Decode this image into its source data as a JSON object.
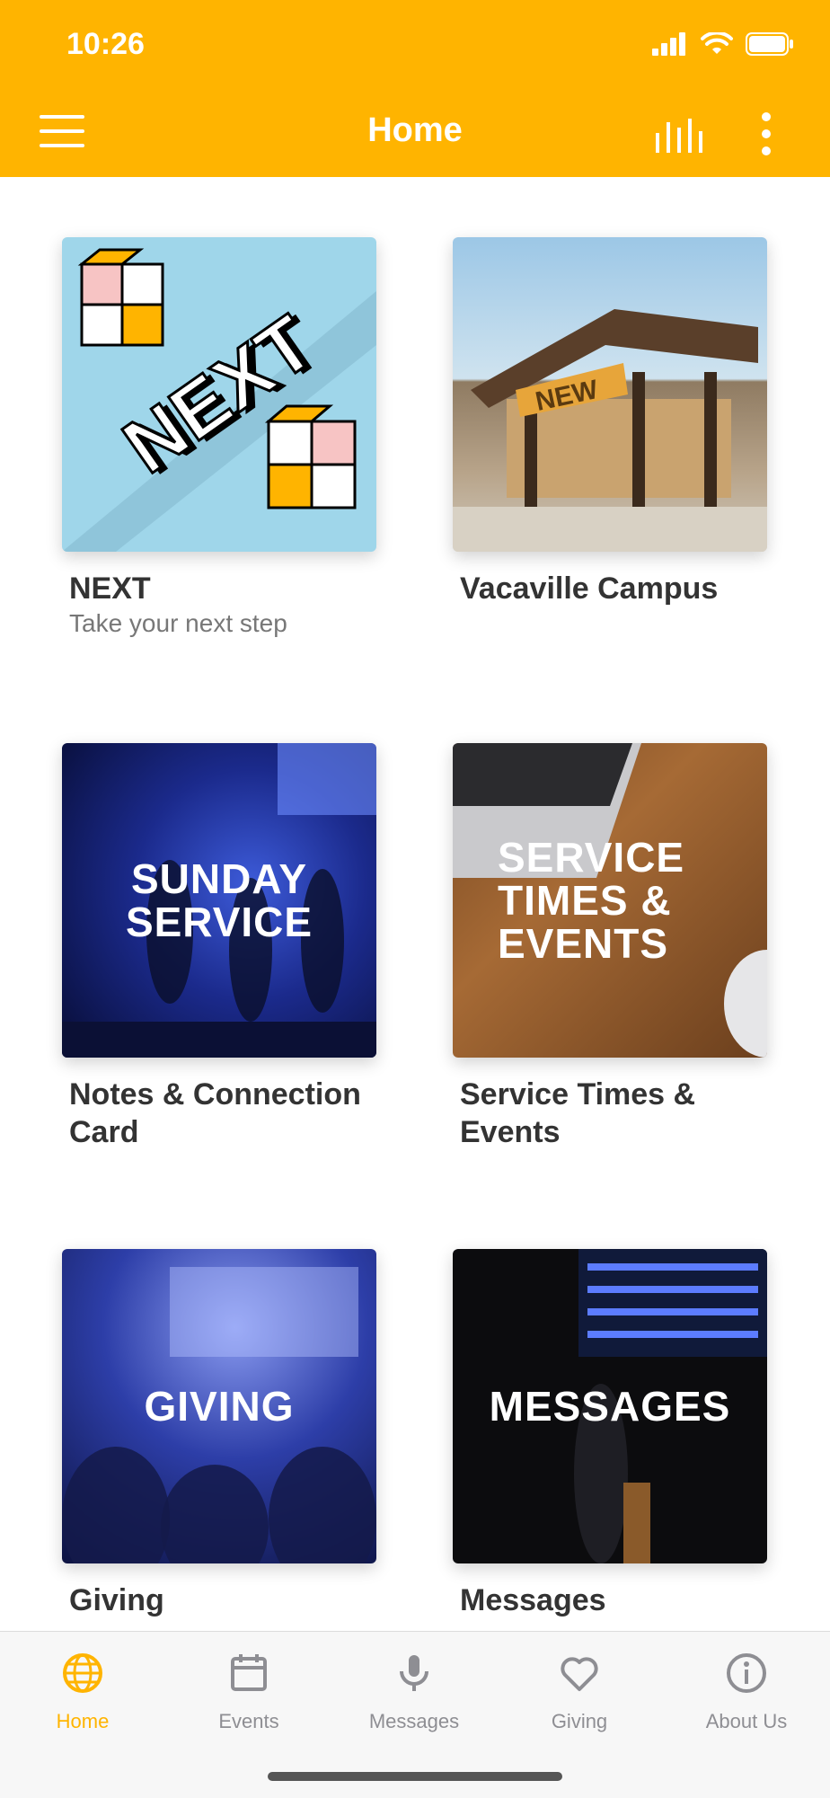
{
  "status": {
    "time": "10:26"
  },
  "header": {
    "title": "Home",
    "bg_color": "#FFB400"
  },
  "tiles": [
    {
      "title": "NEXT",
      "subtitle": "Take your next step",
      "image_text": "NEXT"
    },
    {
      "title": "Vacaville Campus",
      "image_text": "NEW"
    },
    {
      "title": "Notes & Connection Card",
      "image_text": "SUNDAY SERVICE"
    },
    {
      "title": "Service Times & Events",
      "image_text": "SERVICE TIMES & EVENTS"
    },
    {
      "title": "Giving",
      "image_text": "GIVING"
    },
    {
      "title": "Messages",
      "image_text": "MESSAGES"
    }
  ],
  "tabs": [
    {
      "label": "Home",
      "icon": "globe-icon",
      "active": true
    },
    {
      "label": "Events",
      "icon": "calendar-icon"
    },
    {
      "label": "Messages",
      "icon": "microphone-icon"
    },
    {
      "label": "Giving",
      "icon": "heart-icon"
    },
    {
      "label": "About Us",
      "icon": "info-icon"
    }
  ],
  "colors": {
    "accent": "#FFB400",
    "inactive": "#8e8e93"
  }
}
